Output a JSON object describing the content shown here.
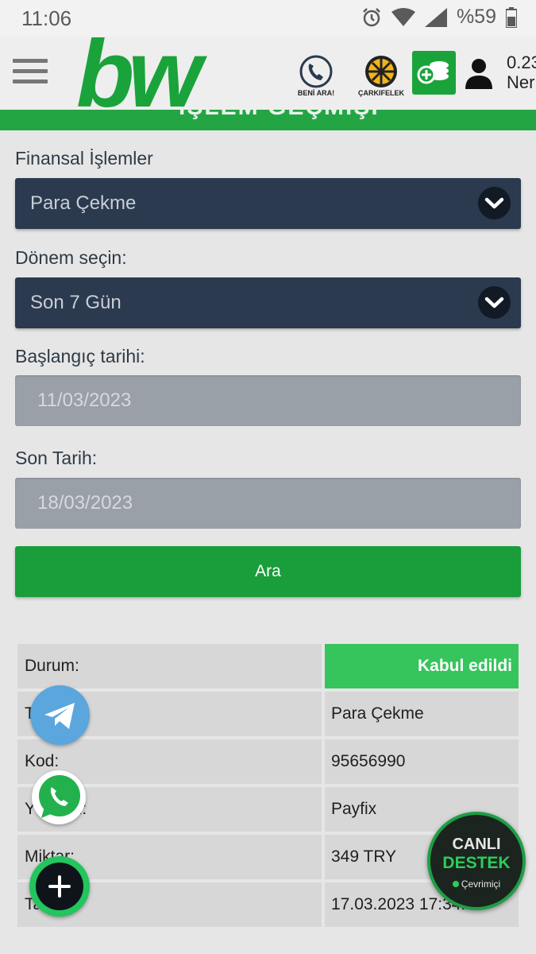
{
  "status": {
    "time": "11:06",
    "battery": "%59"
  },
  "header": {
    "logo": "bw",
    "call_label": "BENİ ARA!",
    "wheel_label": "ÇARKIFELEK",
    "balance_line1": "0.23",
    "balance_line2": "Ner"
  },
  "band": {
    "ghost_title": "İŞLEM GEÇMİŞİ"
  },
  "form": {
    "financial_label": "Finansal İşlemler",
    "financial_value": "Para Çekme",
    "period_label": "Dönem seçin:",
    "period_value": "Son 7 Gün",
    "start_label": "Başlangıç tarihi:",
    "start_value": "11/03/2023",
    "end_label": "Son Tarih:",
    "end_value": "18/03/2023",
    "search_label": "Ara"
  },
  "table": {
    "rows": [
      {
        "key": "Durum:",
        "value": "Kabul edildi"
      },
      {
        "key": "Tür:",
        "value": "Para Çekme"
      },
      {
        "key": "Kod:",
        "value": "95656990"
      },
      {
        "key": "Yöntem:",
        "value": "Payfix"
      },
      {
        "key": "Miktar:",
        "value": "349 TRY"
      },
      {
        "key": "Tarih:",
        "value": "17.03.2023 17:34:31"
      }
    ]
  },
  "support": {
    "line1": "CANLI",
    "line2": "DESTEK",
    "status": "Çevrimiçi"
  },
  "colors": {
    "green": "#24a544",
    "select_bg": "#2b3a4f",
    "accepted": "#36c45c",
    "telegram": "#5aa6dd",
    "whatsapp": "#22b14c"
  }
}
